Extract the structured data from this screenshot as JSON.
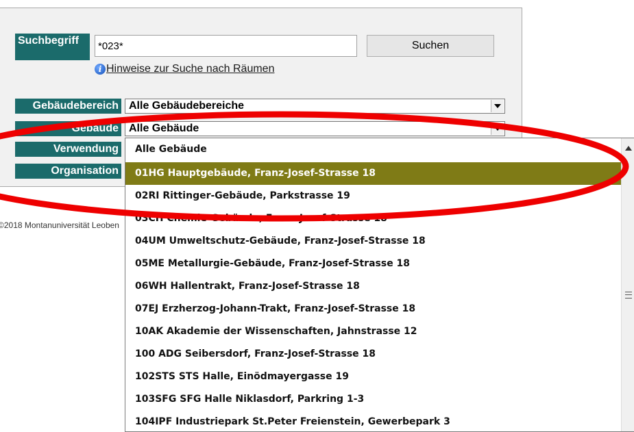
{
  "form": {
    "search_label": "Suchbegriff",
    "search_value": "*023*",
    "search_button": "Suchen",
    "hint_icon": "info-icon",
    "hint_link": "Hinweise zur Suche nach Räumen",
    "fields": [
      {
        "label": "Gebäudebereich",
        "value": "Alle Gebäudebereiche"
      },
      {
        "label": "Gebäude",
        "value": "Alle Gebäude"
      },
      {
        "label": "Verwendung"
      },
      {
        "label": "Organisation"
      }
    ]
  },
  "footer": {
    "text": "©2018 Montanuniversität Leoben"
  },
  "dropdown": {
    "selected_index": 1,
    "selected_color": "#7f7b16",
    "options": [
      "Alle Gebäude",
      "01HG Hauptgebäude, Franz-Josef-Strasse 18",
      "02RI Rittinger-Gebäude, Parkstrasse 19",
      "03CH Chemie-Gebäude, Franz-Josef-Strasse 18",
      "04UM Umweltschutz-Gebäude, Franz-Josef-Strasse 18",
      "05ME Metallurgie-Gebäude, Franz-Josef-Strasse 18",
      "06WH Hallentrakt, Franz-Josef-Strasse 18",
      "07EJ Erzherzog-Johann-Trakt, Franz-Josef-Strasse 18",
      "10AK Akademie der Wissenschaften, Jahnstrasse 12",
      "100 ADG Seibersdorf, Franz-Josef-Strasse 18",
      "102STS STS Halle, Einödmayergasse 19",
      "103SFG SFG Halle Niklasdorf, Parkring 1-3",
      "104IPF Industriepark St.Peter Freienstein, Gewerbepark 3"
    ]
  },
  "annotation": {
    "color": "#ee0000"
  }
}
